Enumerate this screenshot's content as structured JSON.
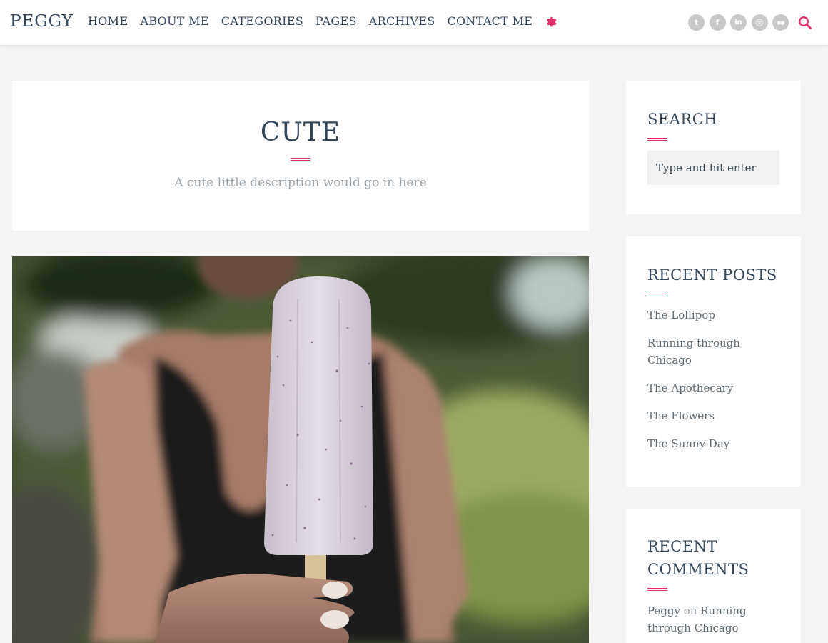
{
  "site": {
    "logo": "PEGGY"
  },
  "nav": {
    "items": [
      {
        "label": "HOME"
      },
      {
        "label": "ABOUT ME"
      },
      {
        "label": "CATEGORIES"
      },
      {
        "label": "PAGES"
      },
      {
        "label": "ARCHIVES"
      },
      {
        "label": "CONTACT ME"
      }
    ],
    "gear_icon": "gear-icon",
    "accent_color": "#e0306e"
  },
  "socials": [
    {
      "icon": "twitter-icon",
      "glyph": "t"
    },
    {
      "icon": "facebook-icon",
      "glyph": "f"
    },
    {
      "icon": "linkedin-icon",
      "glyph": "in"
    },
    {
      "icon": "instagram-icon",
      "glyph": "◎"
    },
    {
      "icon": "flickr-icon",
      "glyph": "●●"
    }
  ],
  "category": {
    "title": "CUTE",
    "description": "A cute little description would go in here"
  },
  "sidebar": {
    "search": {
      "title": "SEARCH",
      "placeholder": "Type and hit enter"
    },
    "recent_posts": {
      "title": "RECENT POSTS",
      "items": [
        "The Lollipop",
        "Running through Chicago",
        "The Apothecary",
        "The Flowers",
        "The Sunny Day"
      ]
    },
    "recent_comments": {
      "title": "RECENT COMMENTS",
      "items": [
        {
          "author": "Peggy",
          "connector": "on",
          "post": "Running through Chicago"
        }
      ]
    }
  }
}
